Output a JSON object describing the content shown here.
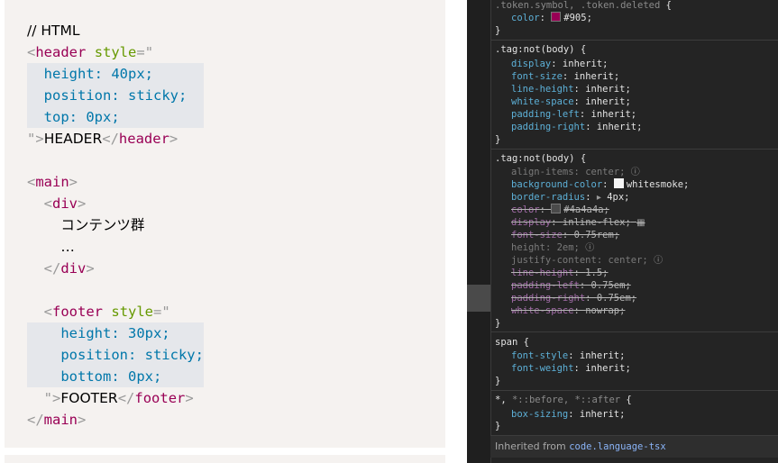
{
  "code": {
    "comment": "// HTML",
    "header_tag": "header",
    "header_attr": "style",
    "header_lines": [
      "height: 40px;",
      "position: sticky;",
      "top: 0px;"
    ],
    "header_text": "HEADER",
    "main_tag": "main",
    "div_tag": "div",
    "content_text": "コンテンツ群",
    "ellipsis": "…",
    "footer_tag": "footer",
    "footer_attr": "style",
    "footer_lines": [
      "height: 30px;",
      "position: sticky;",
      "bottom: 0px;"
    ],
    "footer_text": "FOOTER"
  },
  "devtools": {
    "rule0": {
      "selector": ".token.symbol, .token.deleted",
      "prop": "color",
      "value": "#905",
      "swatch": "#990055"
    },
    "rule1": {
      "selector": ".tag:not(body)",
      "decls": [
        {
          "p": "display",
          "v": "inherit;"
        },
        {
          "p": "font-size",
          "v": "inherit;"
        },
        {
          "p": "line-height",
          "v": "inherit;"
        },
        {
          "p": "white-space",
          "v": "inherit;"
        },
        {
          "p": "padding-left",
          "v": "inherit;"
        },
        {
          "p": "padding-right",
          "v": "inherit;"
        }
      ]
    },
    "rule2": {
      "selector": ".tag:not(body)",
      "align_items": {
        "p": "align-items",
        "v": "center;"
      },
      "background": {
        "p": "background-color",
        "v": "whitesmoke;",
        "swatch": "#f5f5f5"
      },
      "radius": {
        "p": "border-radius",
        "v": "4px;"
      },
      "color": {
        "p": "color",
        "v": "#4a4a4a;",
        "swatch": "#4a4a4a"
      },
      "display": {
        "p": "display",
        "v": "inline-flex;"
      },
      "font_size": {
        "p": "font-size",
        "v": "0.75rem;"
      },
      "height": {
        "p": "height",
        "v": "2em;"
      },
      "justify": {
        "p": "justify-content",
        "v": "center;"
      },
      "line_height": {
        "p": "line-height",
        "v": "1.5;"
      },
      "padding_left": {
        "p": "padding-left",
        "v": "0.75em;"
      },
      "padding_right": {
        "p": "padding-right",
        "v": "0.75em;"
      },
      "white_space": {
        "p": "white-space",
        "v": "nowrap;"
      }
    },
    "rule3": {
      "selector": "span",
      "decls": [
        {
          "p": "font-style",
          "v": "inherit;"
        },
        {
          "p": "font-weight",
          "v": "inherit;"
        }
      ]
    },
    "rule4": {
      "selector_a": "*,",
      "selector_b": "*::before, *::after",
      "decl": {
        "p": "box-sizing",
        "v": "inherit;"
      }
    },
    "inherited_label": "Inherited from",
    "inherited_source": "code.language-tsx"
  }
}
